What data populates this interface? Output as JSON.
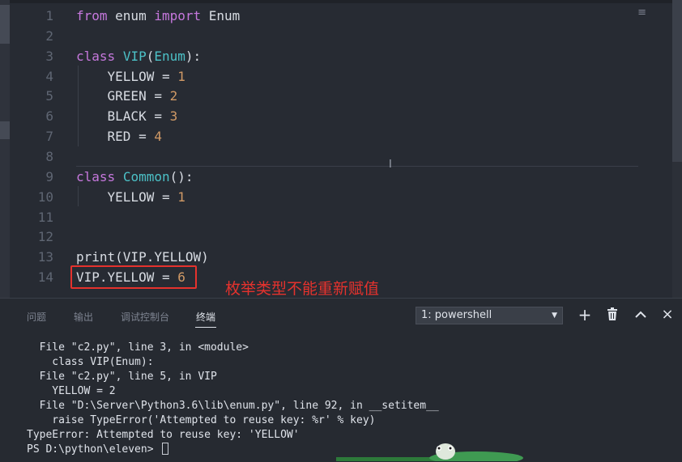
{
  "editor": {
    "lines": [
      {
        "n": "1",
        "tokens": [
          {
            "t": "from",
            "c": "kw"
          },
          {
            "t": " enum ",
            "c": "plain"
          },
          {
            "t": "import",
            "c": "kw"
          },
          {
            "t": " Enum",
            "c": "plain"
          }
        ]
      },
      {
        "n": "2",
        "tokens": []
      },
      {
        "n": "3",
        "tokens": [
          {
            "t": "class",
            "c": "kw"
          },
          {
            "t": " ",
            "c": "plain"
          },
          {
            "t": "VIP",
            "c": "cls"
          },
          {
            "t": "(",
            "c": "plain"
          },
          {
            "t": "Enum",
            "c": "cls"
          },
          {
            "t": "):",
            "c": "plain"
          }
        ]
      },
      {
        "n": "4",
        "tokens": [
          {
            "t": "    YELLOW = ",
            "c": "plain"
          },
          {
            "t": "1",
            "c": "num"
          }
        ]
      },
      {
        "n": "5",
        "tokens": [
          {
            "t": "    GREEN = ",
            "c": "plain"
          },
          {
            "t": "2",
            "c": "num"
          }
        ]
      },
      {
        "n": "6",
        "tokens": [
          {
            "t": "    BLACK = ",
            "c": "plain"
          },
          {
            "t": "3",
            "c": "num"
          }
        ]
      },
      {
        "n": "7",
        "tokens": [
          {
            "t": "    RED = ",
            "c": "plain"
          },
          {
            "t": "4",
            "c": "num"
          }
        ]
      },
      {
        "n": "8",
        "tokens": []
      },
      {
        "n": "9",
        "tokens": [
          {
            "t": "class",
            "c": "kw"
          },
          {
            "t": " ",
            "c": "plain"
          },
          {
            "t": "Common",
            "c": "cls"
          },
          {
            "t": "():",
            "c": "plain"
          }
        ]
      },
      {
        "n": "10",
        "tokens": [
          {
            "t": "    YELLOW = ",
            "c": "plain"
          },
          {
            "t": "1",
            "c": "num"
          }
        ]
      },
      {
        "n": "11",
        "tokens": []
      },
      {
        "n": "12",
        "tokens": []
      },
      {
        "n": "13",
        "tokens": [
          {
            "t": "print(VIP.YELLOW)",
            "c": "plain"
          }
        ]
      },
      {
        "n": "14",
        "tokens": [
          {
            "t": "VIP.YELLOW = ",
            "c": "plain"
          },
          {
            "t": "6",
            "c": "num"
          }
        ]
      }
    ],
    "annotation": "枚举类型不能重新赋值"
  },
  "panel": {
    "tabs": [
      "问题",
      "输出",
      "调试控制台",
      "终端"
    ],
    "active_tab": "终端",
    "terminal_select": "1: powershell",
    "buttons": {
      "add": "+",
      "kill": "🗑",
      "maximize": "⌃",
      "close": "×"
    },
    "terminal_lines": [
      "  File \"c2.py\", line 3, in <module>",
      "    class VIP(Enum):",
      "  File \"c2.py\", line 5, in VIP",
      "    YELLOW = 2",
      "  File \"D:\\Server\\Python3.6\\lib\\enum.py\", line 92, in __setitem__",
      "    raise TypeError('Attempted to reuse key: %r' % key)",
      "TypeError: Attempted to reuse key: 'YELLOW'",
      "PS D:\\python\\eleven> "
    ]
  },
  "colors": {
    "keyword": "#c678dd",
    "class": "#4cc1c7",
    "number": "#d19a66",
    "annotation": "#e5322d"
  }
}
